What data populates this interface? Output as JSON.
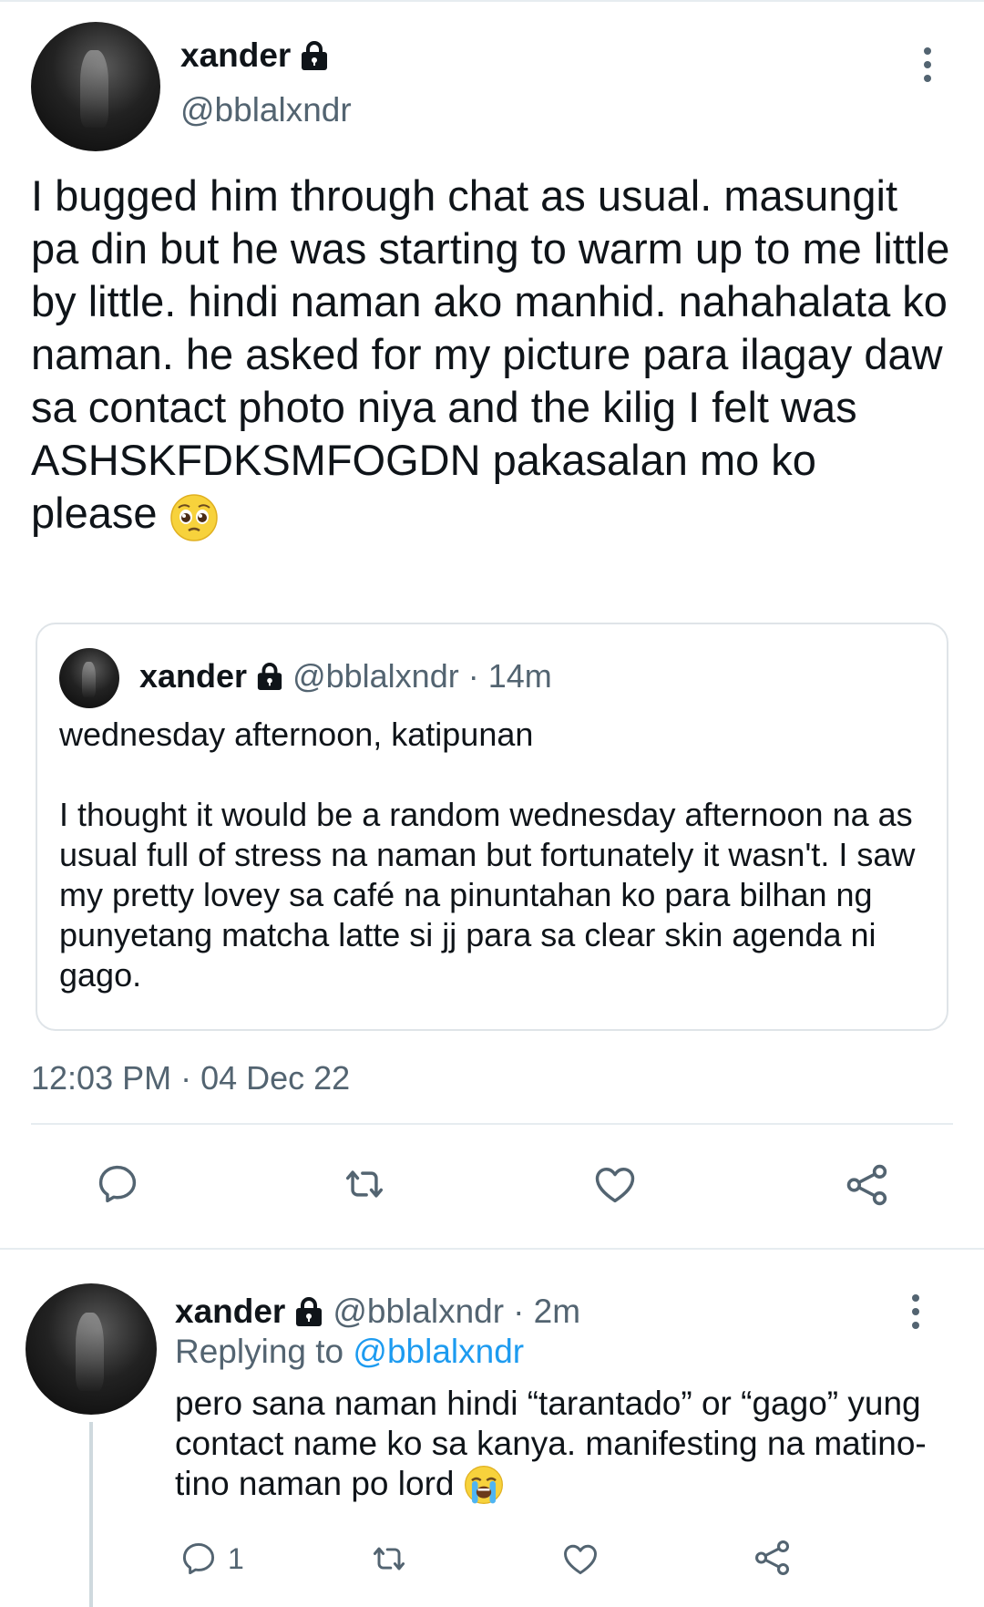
{
  "tweet": {
    "display_name": "xander",
    "handle": "@bblalxndr",
    "text": "I bugged him through chat as usual. masungit pa din but he was starting to warm up to me little by little. hindi naman ako manhid. nahahalata ko naman. he asked for my picture para ilagay daw sa contact photo niya and the kilig I felt was ASHSKFDKSMFOGDN pakasalan mo ko please",
    "emoji": "pleading-face",
    "timestamp": "12:03 PM · 04 Dec 22",
    "quote": {
      "display_name": "xander",
      "handle": "@bblalxndr",
      "time": "· 14m",
      "title": "wednesday afternoon, katipunan",
      "body": "I thought it would be a random wednesday afternoon na as usual full of stress na naman but fortunately it wasn't. I saw my pretty lovey sa café na pinuntahan ko para bilhan ng punyetang matcha latte si jj para sa clear skin agenda ni gago."
    },
    "actions": [
      "reply-icon",
      "retweet-icon",
      "like-icon",
      "share-icon"
    ]
  },
  "reply": {
    "display_name": "xander",
    "handle": "@bblalxndr",
    "time": "· 2m",
    "replying_label": "Replying to",
    "replying_handle": "@bblalxndr",
    "text": "pero sana naman hindi “tarantado” or “gago” yung contact name ko sa kanya. manifesting na matino-tino naman po lord",
    "emoji": "loudly-crying-face",
    "reply_count": "1"
  },
  "colors": {
    "text": "#0f1419",
    "muted": "#536471",
    "link": "#1d9bf0",
    "divider": "#e6ecf0"
  }
}
